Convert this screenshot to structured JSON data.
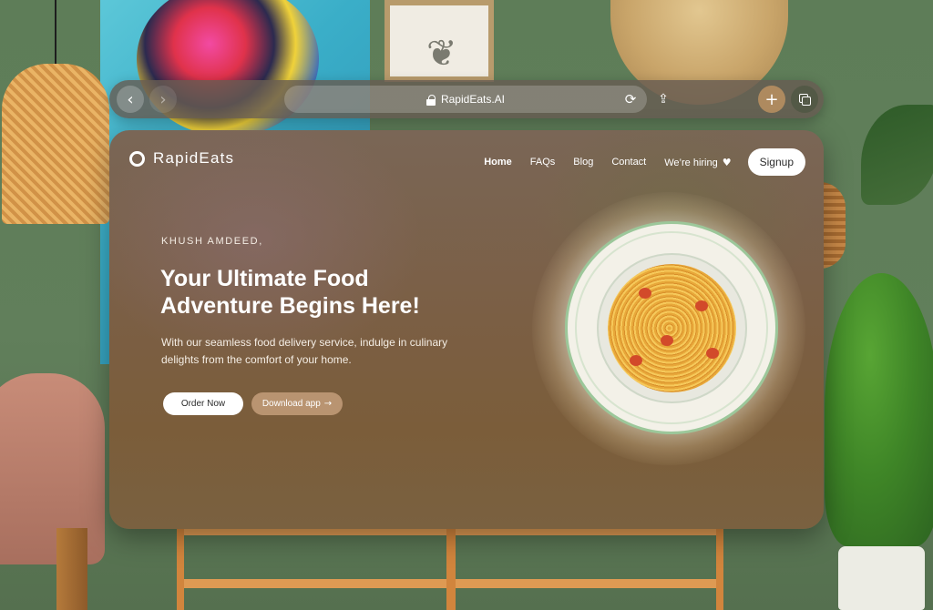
{
  "browser": {
    "url": "RapidEats.AI",
    "back_icon": "chevron-left-icon",
    "forward_icon": "chevron-right-icon"
  },
  "site": {
    "brand": "RapidEats",
    "nav": [
      {
        "label": "Home",
        "active": true
      },
      {
        "label": "FAQs",
        "active": false
      },
      {
        "label": "Blog",
        "active": false
      },
      {
        "label": "Contact",
        "active": false
      },
      {
        "label": "We’re hiring",
        "active": false
      }
    ],
    "signup_label": "Signup"
  },
  "hero": {
    "eyebrow": "KHUSH AMDEED,",
    "headline": "Your Ultimate Food Adventure Begins Here!",
    "subtext": "With our seamless food delivery service, indulge in culinary delights from the comfort of your home.",
    "order_label": "Order Now",
    "download_label": "Download app"
  },
  "colors": {
    "accent": "#c49e7a",
    "white": "#ffffff"
  }
}
